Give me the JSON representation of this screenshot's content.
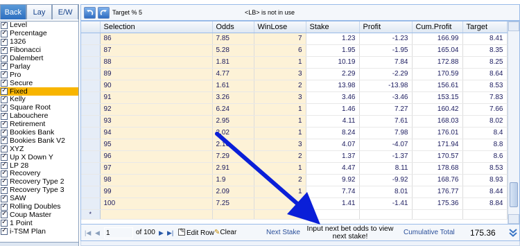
{
  "left": {
    "tabs": [
      "Back",
      "Lay",
      "E/W"
    ],
    "active_tab": "Back",
    "plans": [
      "Level",
      "Percentage",
      "1326",
      "Fibonacci",
      "Dalembert",
      "Parlay",
      "Pro",
      "Secure",
      "Fixed",
      "Kelly",
      "Square Root",
      "Labouchere",
      "Retirement",
      "Bookies Bank",
      "Bookies Bank V2",
      "XYZ",
      "Up X Down Y",
      "LP 28",
      "Recovery",
      "Recovery Type 2",
      "Recovery Type 3",
      "SAW",
      "Rolling Doubles",
      "Coup Master",
      "1 Point",
      "i-TSM Plan"
    ],
    "selected_plan": "Fixed"
  },
  "toolbar": {
    "target_label": "Target % 5",
    "lb_label": "<LB> is not in use"
  },
  "grid": {
    "columns": [
      "Selection",
      "Odds",
      "WinLose",
      "Stake",
      "Profit",
      "Cum.Profit",
      "Target"
    ],
    "rows": [
      [
        "86",
        "7.85",
        "7",
        "1.23",
        "-1.23",
        "166.99",
        "8.41"
      ],
      [
        "87",
        "5.28",
        "6",
        "1.95",
        "-1.95",
        "165.04",
        "8.35"
      ],
      [
        "88",
        "1.81",
        "1",
        "10.19",
        "7.84",
        "172.88",
        "8.25"
      ],
      [
        "89",
        "4.77",
        "3",
        "2.29",
        "-2.29",
        "170.59",
        "8.64"
      ],
      [
        "90",
        "1.61",
        "2",
        "13.98",
        "-13.98",
        "156.61",
        "8.53"
      ],
      [
        "91",
        "3.26",
        "3",
        "3.46",
        "-3.46",
        "153.15",
        "7.83"
      ],
      [
        "92",
        "6.24",
        "1",
        "1.46",
        "7.27",
        "160.42",
        "7.66"
      ],
      [
        "93",
        "2.95",
        "1",
        "4.11",
        "7.61",
        "168.03",
        "8.02"
      ],
      [
        "94",
        "2.02",
        "1",
        "8.24",
        "7.98",
        "176.01",
        "8.4"
      ],
      [
        "95",
        "2.16",
        "3",
        "4.07",
        "-4.07",
        "171.94",
        "8.8"
      ],
      [
        "96",
        "7.29",
        "2",
        "1.37",
        "-1.37",
        "170.57",
        "8.6"
      ],
      [
        "97",
        "2.91",
        "1",
        "4.47",
        "8.11",
        "178.68",
        "8.53"
      ],
      [
        "98",
        "1.9",
        "2",
        "9.92",
        "-9.92",
        "168.76",
        "8.93"
      ],
      [
        "99",
        "2.09",
        "1",
        "7.74",
        "8.01",
        "176.77",
        "8.44"
      ],
      [
        "100",
        "7.25",
        "4",
        "1.41",
        "-1.41",
        "175.36",
        "8.84"
      ]
    ],
    "new_row_marker": "*"
  },
  "footer": {
    "page": "1",
    "of_pages": "of 100",
    "edit_row": "Edit Row",
    "clear": "Clear",
    "next_stake": "Next Stake",
    "hint": "Input next bet odds to view next stake!",
    "cumulative_label": "Cumulative Total",
    "cumulative_value": "175.36"
  },
  "colors": {
    "arrow": "#0a1fd8",
    "selected_plan": "#f8b500",
    "tab_active": "#2c6fc0",
    "edit_column": "#fdf2d7"
  }
}
